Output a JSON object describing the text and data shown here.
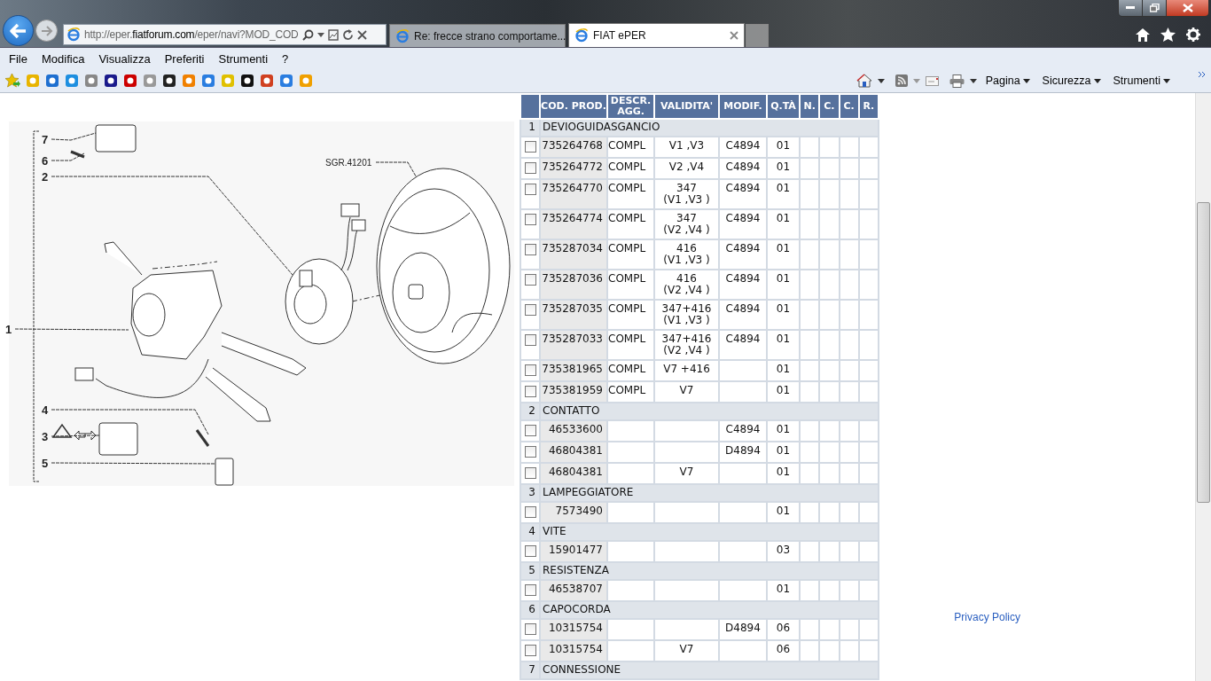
{
  "browser": {
    "address": {
      "before": "http://eper.",
      "domain": "fiatforum.com",
      "after": "/eper/navi?MOD_COD"
    },
    "tabs": [
      {
        "title": "Re: frecce strano comportame...",
        "selected": false
      },
      {
        "title": "FIAT ePER",
        "selected": true
      }
    ],
    "menu": [
      "File",
      "Modifica",
      "Visualizza",
      "Preferiti",
      "Strumenti",
      "?"
    ],
    "command_bar": [
      "Pagina",
      "Sicurezza",
      "Strumenti"
    ]
  },
  "diagram": {
    "reference": "SGR.41201",
    "callouts": [
      "7",
      "6",
      "2",
      "1",
      "4",
      "3",
      "5"
    ]
  },
  "table": {
    "columns": [
      "COD. PROD.",
      "DESCR. AGG.",
      "VALIDITA'",
      "MODIF.",
      "Q.TÀ",
      "N.",
      "C.",
      "C.",
      "R."
    ],
    "groups": [
      {
        "number": "1",
        "name": "DEVIOGUIDASGANCIO",
        "rows": [
          {
            "code": "735264768",
            "descr": "COMPL",
            "validity": [
              "V1 ,V3"
            ],
            "modif": "C4894",
            "qty": "01",
            "checked": false
          },
          {
            "code": "735264772",
            "descr": "COMPL",
            "validity": [
              "V2 ,V4"
            ],
            "modif": "C4894",
            "qty": "01",
            "checked": false
          },
          {
            "code": "735264770",
            "descr": "COMPL",
            "validity": [
              "347",
              "(V1 ,V3 )"
            ],
            "modif": "C4894",
            "qty": "01",
            "checked": false
          },
          {
            "code": "735264774",
            "descr": "COMPL",
            "validity": [
              "347",
              "(V2 ,V4 )"
            ],
            "modif": "C4894",
            "qty": "01",
            "checked": false
          },
          {
            "code": "735287034",
            "descr": "COMPL",
            "validity": [
              "416",
              "(V1 ,V3 )"
            ],
            "modif": "C4894",
            "qty": "01",
            "checked": false
          },
          {
            "code": "735287036",
            "descr": "COMPL",
            "validity": [
              "416",
              "(V2 ,V4 )"
            ],
            "modif": "C4894",
            "qty": "01",
            "checked": false
          },
          {
            "code": "735287035",
            "descr": "COMPL",
            "validity": [
              "347+416",
              "(V1 ,V3 )"
            ],
            "modif": "C4894",
            "qty": "01",
            "checked": false
          },
          {
            "code": "735287033",
            "descr": "COMPL",
            "validity": [
              "347+416",
              "(V2 ,V4 )"
            ],
            "modif": "C4894",
            "qty": "01",
            "checked": false
          },
          {
            "code": "735381965",
            "descr": "COMPL",
            "validity": [
              "V7 +416"
            ],
            "modif": "",
            "qty": "01",
            "checked": false
          },
          {
            "code": "735381959",
            "descr": "COMPL",
            "validity": [
              "V7"
            ],
            "modif": "",
            "qty": "01",
            "checked": false
          }
        ]
      },
      {
        "number": "2",
        "name": "CONTATTO",
        "rows": [
          {
            "code": "46533600",
            "descr": "",
            "validity": [],
            "modif": "C4894",
            "qty": "01",
            "checked": false
          },
          {
            "code": "46804381",
            "descr": "",
            "validity": [],
            "modif": "D4894",
            "qty": "01",
            "checked": false
          },
          {
            "code": "46804381",
            "descr": "",
            "validity": [
              "V7"
            ],
            "modif": "",
            "qty": "01",
            "checked": false
          }
        ]
      },
      {
        "number": "3",
        "name": "LAMPEGGIATORE",
        "rows": [
          {
            "code": "7573490",
            "descr": "",
            "validity": [],
            "modif": "",
            "qty": "01",
            "checked": false
          }
        ]
      },
      {
        "number": "4",
        "name": "VITE",
        "rows": [
          {
            "code": "15901477",
            "descr": "",
            "validity": [],
            "modif": "",
            "qty": "03",
            "checked": false
          }
        ]
      },
      {
        "number": "5",
        "name": "RESISTENZA",
        "rows": [
          {
            "code": "46538707",
            "descr": "",
            "validity": [],
            "modif": "",
            "qty": "01",
            "checked": false
          }
        ]
      },
      {
        "number": "6",
        "name": "CAPOCORDA",
        "rows": [
          {
            "code": "10315754",
            "descr": "",
            "validity": [],
            "modif": "D4894",
            "qty": "06",
            "checked": false
          },
          {
            "code": "10315754",
            "descr": "",
            "validity": [
              "V7"
            ],
            "modif": "",
            "qty": "06",
            "checked": false
          }
        ]
      },
      {
        "number": "7",
        "name": "CONNESSIONE"
      }
    ]
  },
  "privacy_link": "Privacy Policy"
}
